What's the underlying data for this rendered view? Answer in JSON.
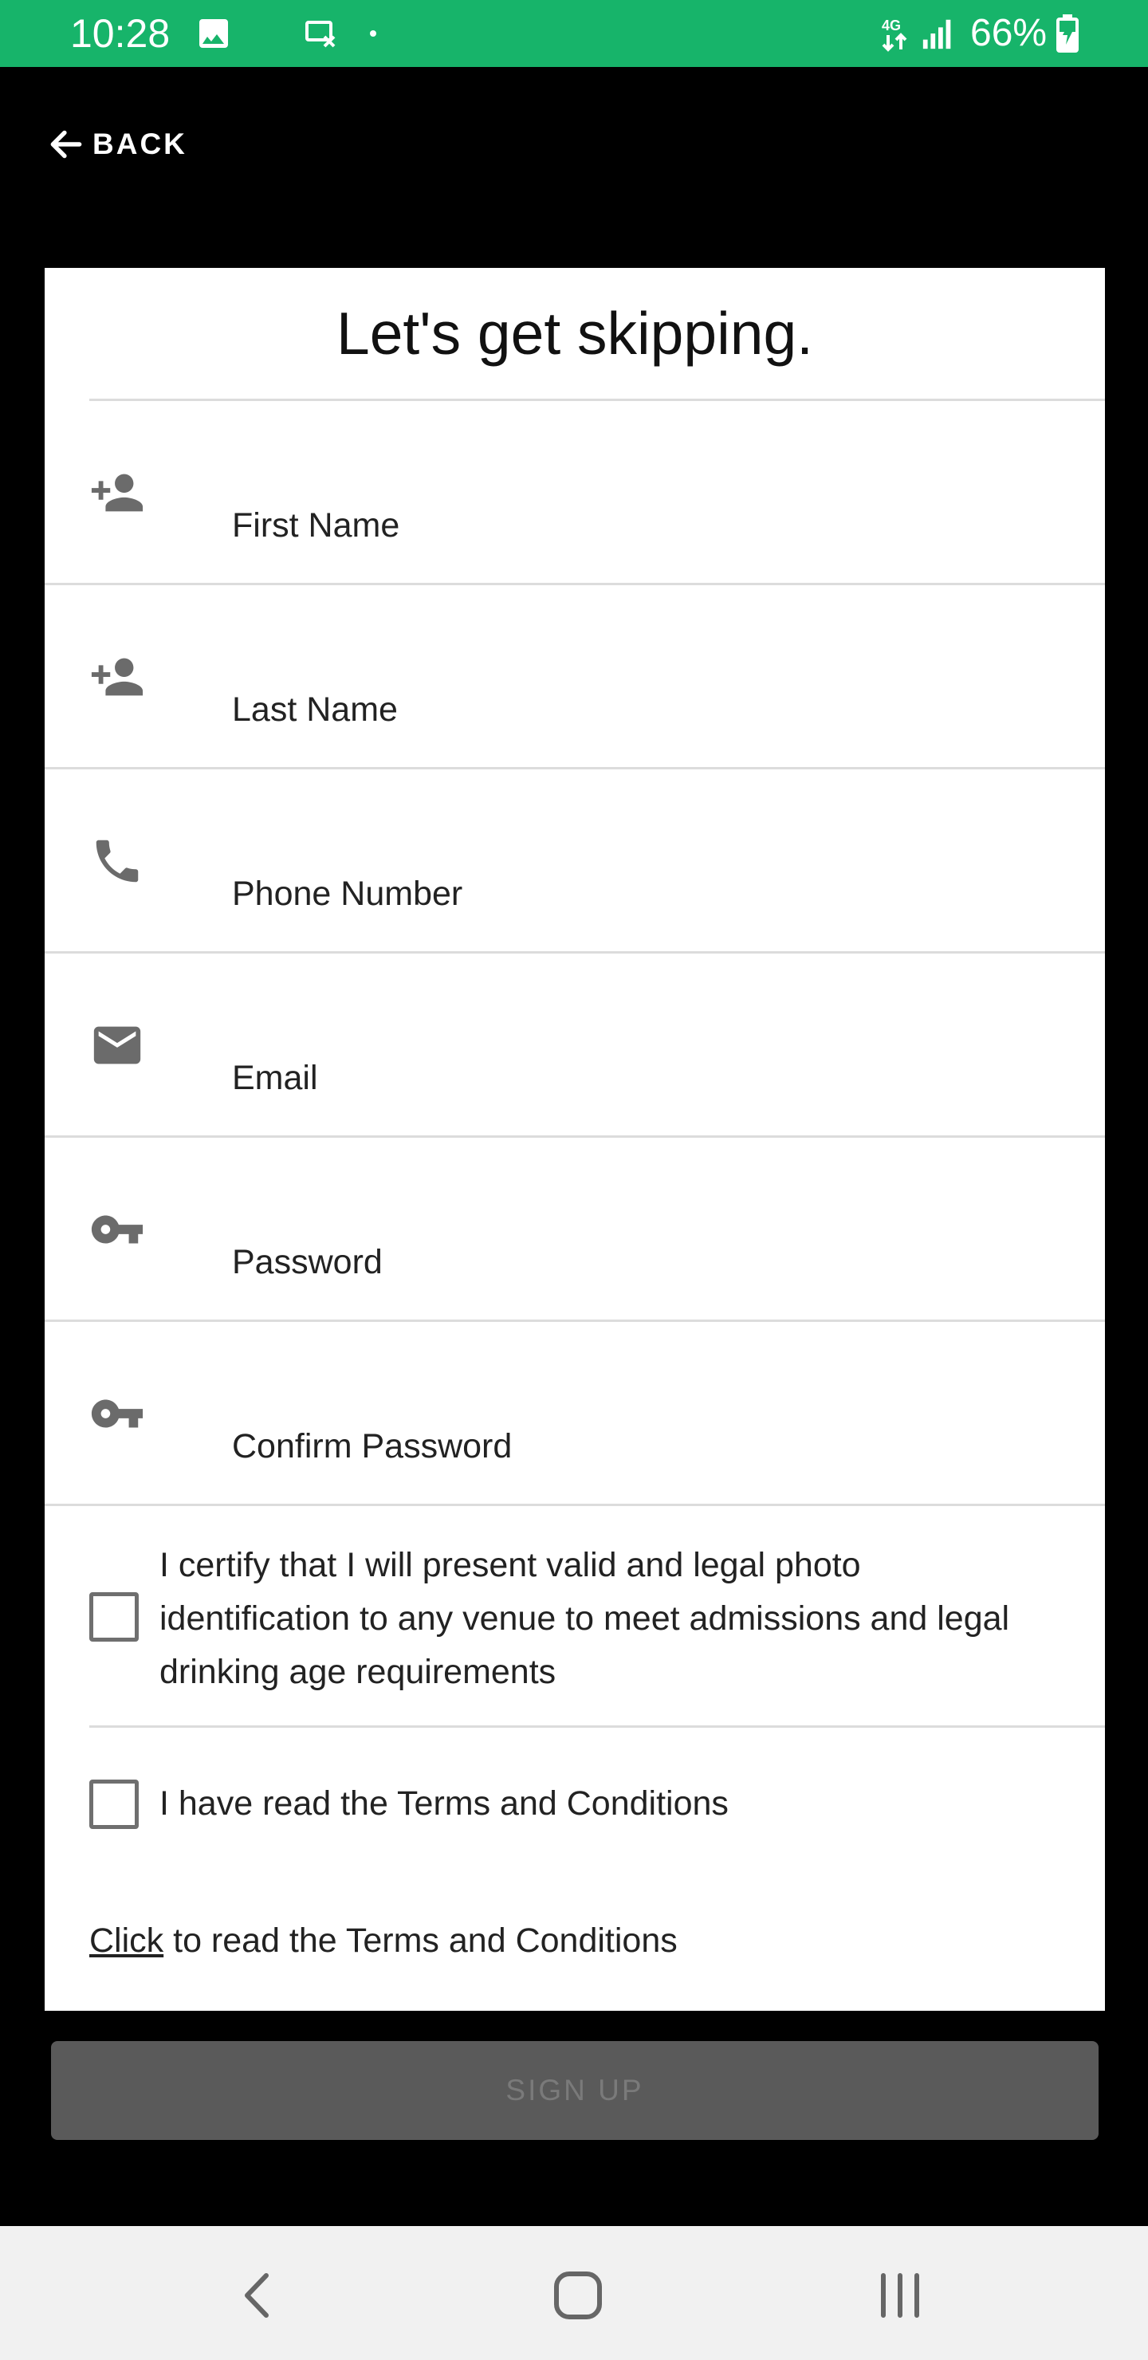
{
  "status_bar": {
    "time": "10:28",
    "battery": "66%",
    "icons": [
      "image-icon",
      "card-notification-icon",
      "dot-icon",
      "data-4g-icon",
      "signal-icon",
      "battery-charging-icon"
    ],
    "color": "#17b46a"
  },
  "header": {
    "back_label": "BACK"
  },
  "form": {
    "title": "Let's get skipping.",
    "fields": [
      {
        "placeholder": "First Name",
        "icon": "person-add-icon"
      },
      {
        "placeholder": "Last Name",
        "icon": "person-add-icon"
      },
      {
        "placeholder": "Phone Number",
        "icon": "phone-icon"
      },
      {
        "placeholder": "Email",
        "icon": "email-icon"
      },
      {
        "placeholder": "Password",
        "icon": "key-icon"
      },
      {
        "placeholder": "Confirm Password",
        "icon": "key-icon"
      }
    ],
    "certify_lines": [
      "I certify that I will present valid and legal photo",
      "identification to any venue to meet admissions and legal",
      "drinking age requirements"
    ],
    "terms_checkbox_label": "I have read the Terms and Conditions",
    "terms_link_text": "Click",
    "terms_rest_text": " to read the Terms and Conditions"
  },
  "signup_label": "SIGN UP",
  "nav": {
    "icons": [
      "back-nav-icon",
      "home-nav-icon",
      "recents-nav-icon"
    ]
  }
}
